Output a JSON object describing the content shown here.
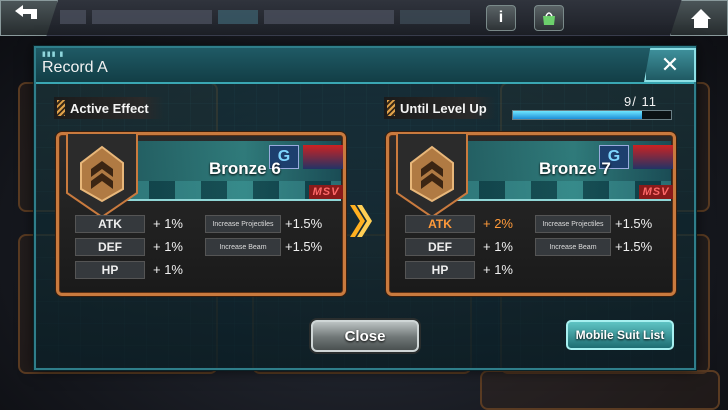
{
  "modal": {
    "title": "Record A",
    "close_icon": "close-x-icon"
  },
  "active_effect": {
    "label": "Active Effect",
    "rank": "Bronze 6",
    "stats_left": [
      {
        "name": "ATK",
        "value": "+ 1%"
      },
      {
        "name": "DEF",
        "value": "+ 1%"
      },
      {
        "name": "HP",
        "value": "+ 1%"
      }
    ],
    "stats_right": [
      {
        "name": "Increase Projectiles",
        "value": "+1.5%"
      },
      {
        "name": "Increase Beam",
        "value": "+1.5%"
      }
    ]
  },
  "level_up": {
    "label": "Until Level Up",
    "progress_text": "9/ 11",
    "progress_fraction": 0.818,
    "rank": "Bronze 7",
    "stats_left": [
      {
        "name": "ATK",
        "value": "+ 2%",
        "highlight": true
      },
      {
        "name": "DEF",
        "value": "+ 1%"
      },
      {
        "name": "HP",
        "value": "+ 1%"
      }
    ],
    "stats_right": [
      {
        "name": "Increase Projectiles",
        "value": "+1.5%"
      },
      {
        "name": "Increase Beam",
        "value": "+1.5%"
      }
    ]
  },
  "logos": {
    "gundam": "G",
    "msv": "MSV"
  },
  "buttons": {
    "close": "Close",
    "mobile_suit_list": "Mobile Suit List"
  },
  "colors": {
    "accent_teal": "#2f7e8a",
    "card_border": "#c97a3e",
    "highlight": "#ff9a3a",
    "progress": "#1f8fd8"
  }
}
